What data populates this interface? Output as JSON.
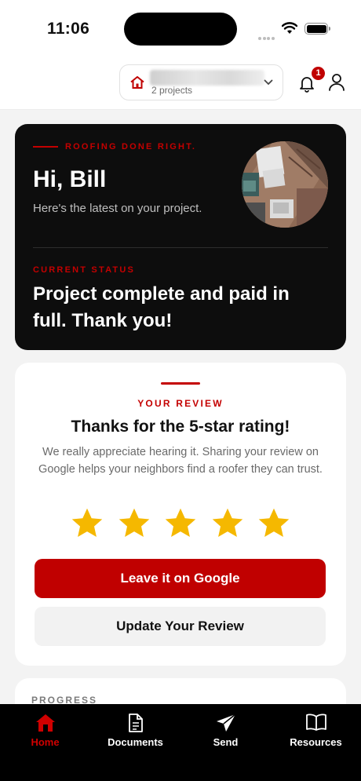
{
  "status_bar": {
    "time": "11:06"
  },
  "header": {
    "project_subtitle": "2 projects",
    "notification_count": "1"
  },
  "hero": {
    "kicker": "ROOFING DONE RIGHT.",
    "greeting": "Hi, Bill",
    "subtitle": "Here's the latest on your project.",
    "status_label": "CURRENT STATUS",
    "status_text": "Project complete and paid in full. Thank you!"
  },
  "review": {
    "kicker": "YOUR REVIEW",
    "title": "Thanks for the 5-star rating!",
    "body": "We really appreciate hearing it. Sharing your review on Google helps your neighbors find a roofer they can trust.",
    "rating": 5,
    "star_color": "#f5b800",
    "primary_button": "Leave it on Google",
    "secondary_button": "Update Your Review"
  },
  "progress": {
    "label": "PROGRESS"
  },
  "tabs": [
    {
      "label": "Home",
      "icon": "home-icon",
      "active": true
    },
    {
      "label": "Documents",
      "icon": "document-icon",
      "active": false
    },
    {
      "label": "Send",
      "icon": "send-icon",
      "active": false
    },
    {
      "label": "Resources",
      "icon": "book-icon",
      "active": false
    }
  ],
  "colors": {
    "accent": "#c00000",
    "hero_bg": "#0d0d0d",
    "page_bg": "#f3f3f3"
  }
}
